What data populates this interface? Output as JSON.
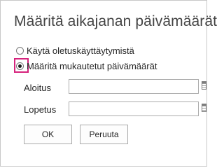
{
  "dialog": {
    "title": "Määritä aikajanan päivämäärät",
    "options": [
      {
        "label": "Käytä oletuskäyttäytymistä",
        "selected": false
      },
      {
        "label": "Määritä mukautetut päivämäärät",
        "selected": true
      }
    ],
    "fields": {
      "start": {
        "label": "Aloitus",
        "value": ""
      },
      "end": {
        "label": "Lopetus",
        "value": ""
      }
    },
    "buttons": {
      "ok": "OK",
      "cancel": "Peruuta"
    },
    "colors": {
      "highlight": "#d6237d"
    },
    "icons": {
      "date_picker": "calendar-icon"
    }
  }
}
